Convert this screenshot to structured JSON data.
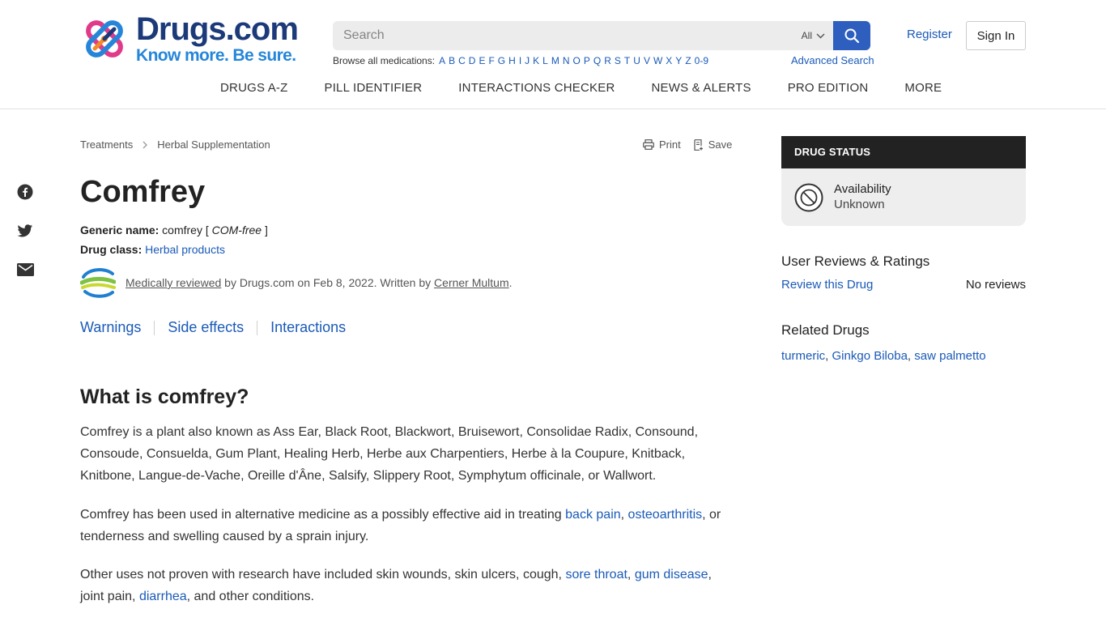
{
  "brand": {
    "name": "Drugs.com",
    "tagline": "Know more. Be sure."
  },
  "search": {
    "placeholder": "Search",
    "scope": "All"
  },
  "browse": {
    "label": "Browse all medications:",
    "letters": [
      "A",
      "B",
      "C",
      "D",
      "E",
      "F",
      "G",
      "H",
      "I",
      "J",
      "K",
      "L",
      "M",
      "N",
      "O",
      "P",
      "Q",
      "R",
      "S",
      "T",
      "U",
      "V",
      "W",
      "X",
      "Y",
      "Z",
      "0-9"
    ],
    "advanced": "Advanced Search"
  },
  "account": {
    "register": "Register",
    "signin": "Sign In"
  },
  "nav": [
    "DRUGS A-Z",
    "PILL IDENTIFIER",
    "INTERACTIONS CHECKER",
    "NEWS & ALERTS",
    "PRO EDITION",
    "MORE"
  ],
  "breadcrumb": [
    "Treatments",
    "Herbal Supplementation"
  ],
  "tools": {
    "print": "Print",
    "save": "Save"
  },
  "drug": {
    "title": "Comfrey",
    "generic_label": "Generic name:",
    "generic_value": "comfrey",
    "pronunciation": "COM-free",
    "class_label": "Drug class:",
    "class_value": "Herbal products"
  },
  "review": {
    "link": "Medically reviewed",
    "by": " by Drugs.com on Feb 8, 2022. Written by ",
    "author": "Cerner Multum",
    "end": "."
  },
  "jump_links": [
    "Warnings",
    "Side effects",
    "Interactions"
  ],
  "section": {
    "heading": "What is comfrey?",
    "p1": "Comfrey is a plant also known as Ass Ear, Black Root, Blackwort, Bruisewort, Consolidae Radix, Consound, Consoude, Consuelda, Gum Plant, Healing Herb, Herbe aux Charpentiers, Herbe à la Coupure, Knitback, Knitbone, Langue-de-Vache, Oreille d'Âne, Salsify, Slippery Root, Symphytum officinale, or Wallwort.",
    "p2": {
      "t1": "Comfrey has been used in alternative medicine as a possibly effective aid in treating ",
      "l1": "back pain",
      "t2": ", ",
      "l2": "osteoarthritis",
      "t3": ", or tenderness and swelling caused by a sprain injury."
    },
    "p3": {
      "t1": "Other uses not proven with research have included skin wounds, skin ulcers, cough, ",
      "l1": "sore throat",
      "t2": ", ",
      "l2": "gum disease",
      "t3": ", joint pain, ",
      "l3": "diarrhea",
      "t4": ", and other conditions."
    }
  },
  "sidebar": {
    "status_title": "DRUG STATUS",
    "availability_label": "Availability",
    "availability_value": "Unknown",
    "reviews_title": "User Reviews & Ratings",
    "review_link": "Review this Drug",
    "review_count": "No reviews",
    "related_title": "Related Drugs",
    "related": [
      "turmeric",
      "Ginkgo Biloba",
      "saw palmetto"
    ]
  },
  "icons": [
    "facebook-icon",
    "twitter-icon",
    "email-icon",
    "search-icon",
    "chevron-down-icon",
    "print-icon",
    "save-icon",
    "unavailable-icon"
  ],
  "colors": {
    "brand_dark": "#1c3a7a",
    "brand_light": "#2586d9",
    "link": "#1a5ab8",
    "search_button": "#2e5fbf",
    "status_header": "#222222"
  }
}
